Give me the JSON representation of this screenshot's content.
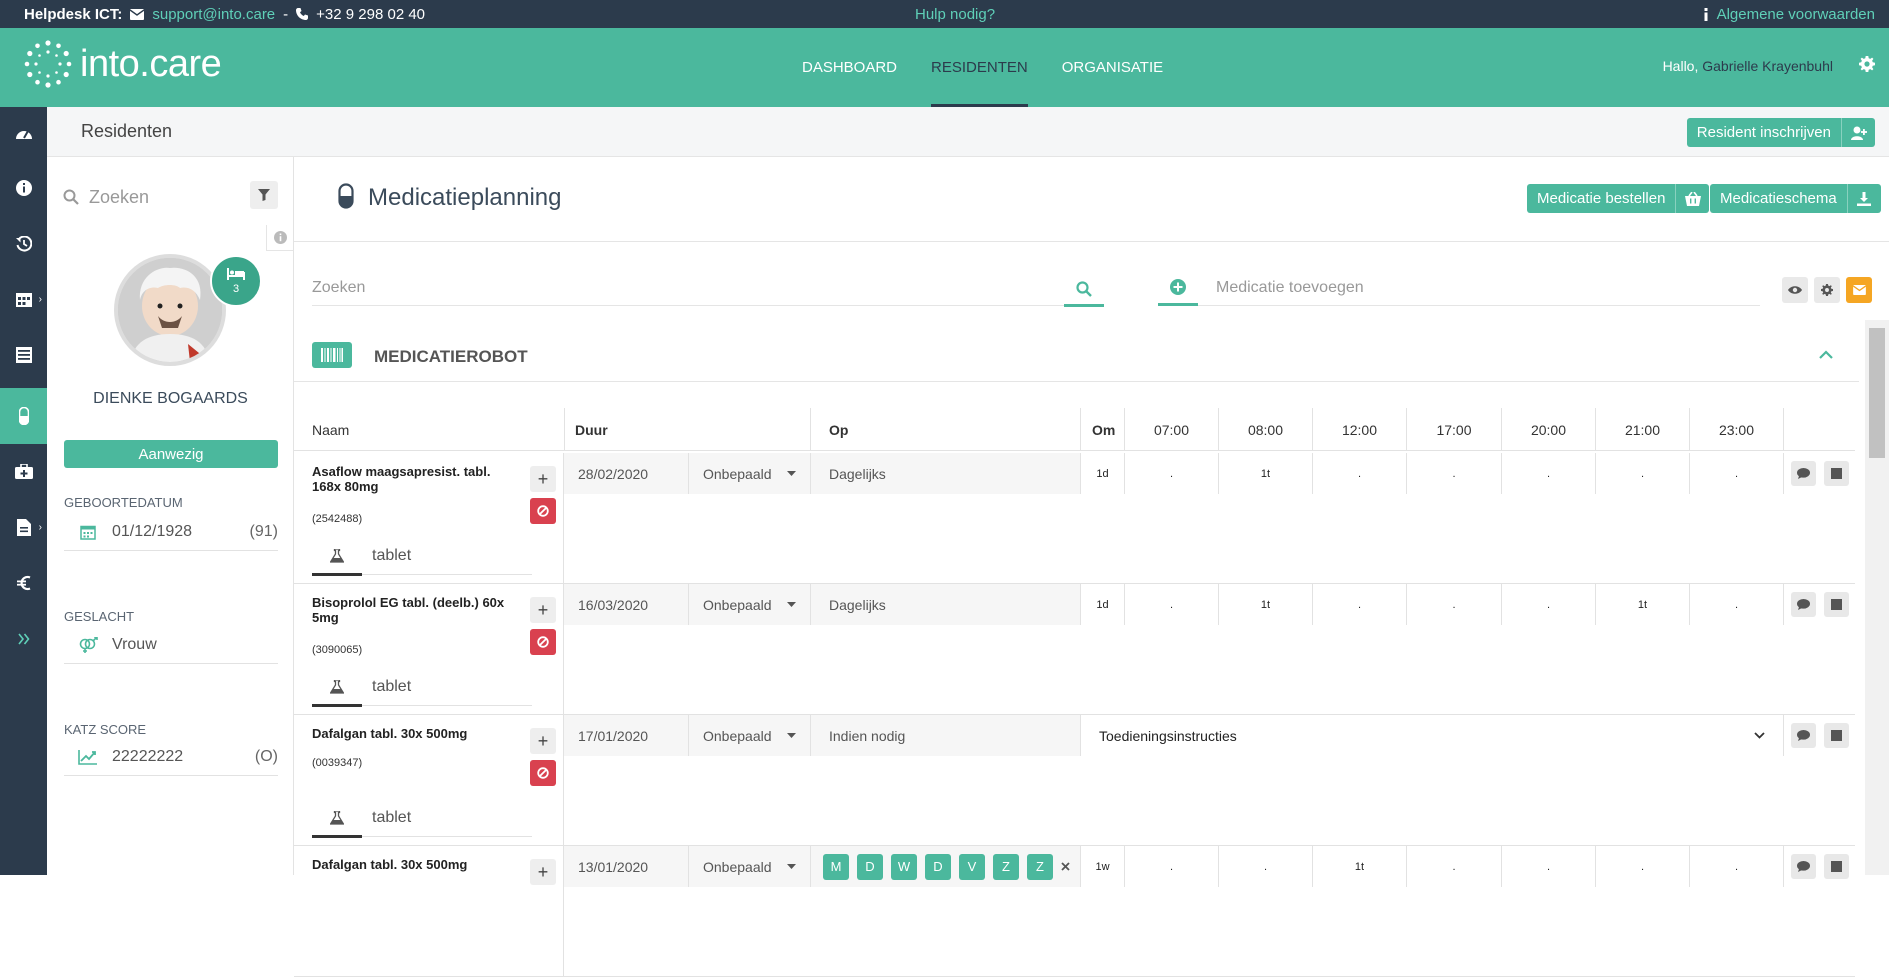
{
  "topbar": {
    "helpdesk_label": "Helpdesk ICT:",
    "email": "support@into.care",
    "separator": "-",
    "phone": "+32 9 298 02 40",
    "help": "Hulp nodig?",
    "terms": "Algemene voorwaarden"
  },
  "header": {
    "logo_text": "into.care",
    "nav": [
      "DASHBOARD",
      "RESIDENTEN",
      "ORGANISATIE"
    ],
    "active_nav": "RESIDENTEN",
    "hello": "Hallo,",
    "user_name": "Gabrielle Krayenbuhl"
  },
  "subheader": {
    "title": "Residenten",
    "enroll_button": "Resident inschrijven"
  },
  "left_panel": {
    "search_placeholder": "Zoeken",
    "bed_count": "3",
    "resident_name": "DIENKE BOGAARDS",
    "status_button": "Aanwezig",
    "birth_label": "GEBOORTEDATUM",
    "birth_date": "01/12/1928",
    "age": "(91)",
    "gender_label": "GESLACHT",
    "gender": "Vrouw",
    "katz_label": "KATZ SCORE",
    "katz": "22222222",
    "katz_extra": "(O)"
  },
  "main": {
    "title": "Medicatieplanning",
    "order_button": "Medicatie bestellen",
    "schema_button": "Medicatieschema",
    "search_placeholder": "Zoeken",
    "add_placeholder": "Medicatie toevoegen",
    "section_title": "MEDICATIEROBOT",
    "colors": {
      "accent": "#4bb89d",
      "dark": "#2c3b4c",
      "danger": "#d9414f",
      "warning": "#f5a623"
    }
  },
  "table": {
    "headers": {
      "name": "Naam",
      "duration": "Duur",
      "on": "Op",
      "every": "Om"
    },
    "times": [
      "07:00",
      "08:00",
      "12:00",
      "17:00",
      "20:00",
      "21:00",
      "23:00"
    ],
    "rows": [
      {
        "name": "Asaflow maagsapresist. tabl. 168x 80mg",
        "code": "(2542488)",
        "form": "tablet",
        "date": "28/02/2020",
        "duration": "Onbepaald",
        "on": "Dagelijks",
        "every": "1d",
        "slots": [
          ".",
          "1t",
          ".",
          ".",
          ".",
          ".",
          "."
        ]
      },
      {
        "name": "Bisoprolol EG tabl. (deelb.) 60x 5mg",
        "code": "(3090065)",
        "form": "tablet",
        "date": "16/03/2020",
        "duration": "Onbepaald",
        "on": "Dagelijks",
        "every": "1d",
        "slots": [
          ".",
          "1t",
          ".",
          ".",
          ".",
          "1t",
          "."
        ]
      },
      {
        "name": "Dafalgan tabl. 30x 500mg",
        "code": "(0039347)",
        "form": "tablet",
        "date": "17/01/2020",
        "duration": "Onbepaald",
        "on": "Indien nodig",
        "instructions": "Toedieningsinstructies"
      },
      {
        "name": "Dafalgan tabl. 30x 500mg",
        "date": "13/01/2020",
        "duration": "Onbepaald",
        "days": [
          "M",
          "D",
          "W",
          "D",
          "V",
          "Z",
          "Z"
        ],
        "every": "1w",
        "slots": [
          ".",
          ".",
          "1t",
          ".",
          ".",
          ".",
          "."
        ]
      }
    ]
  }
}
